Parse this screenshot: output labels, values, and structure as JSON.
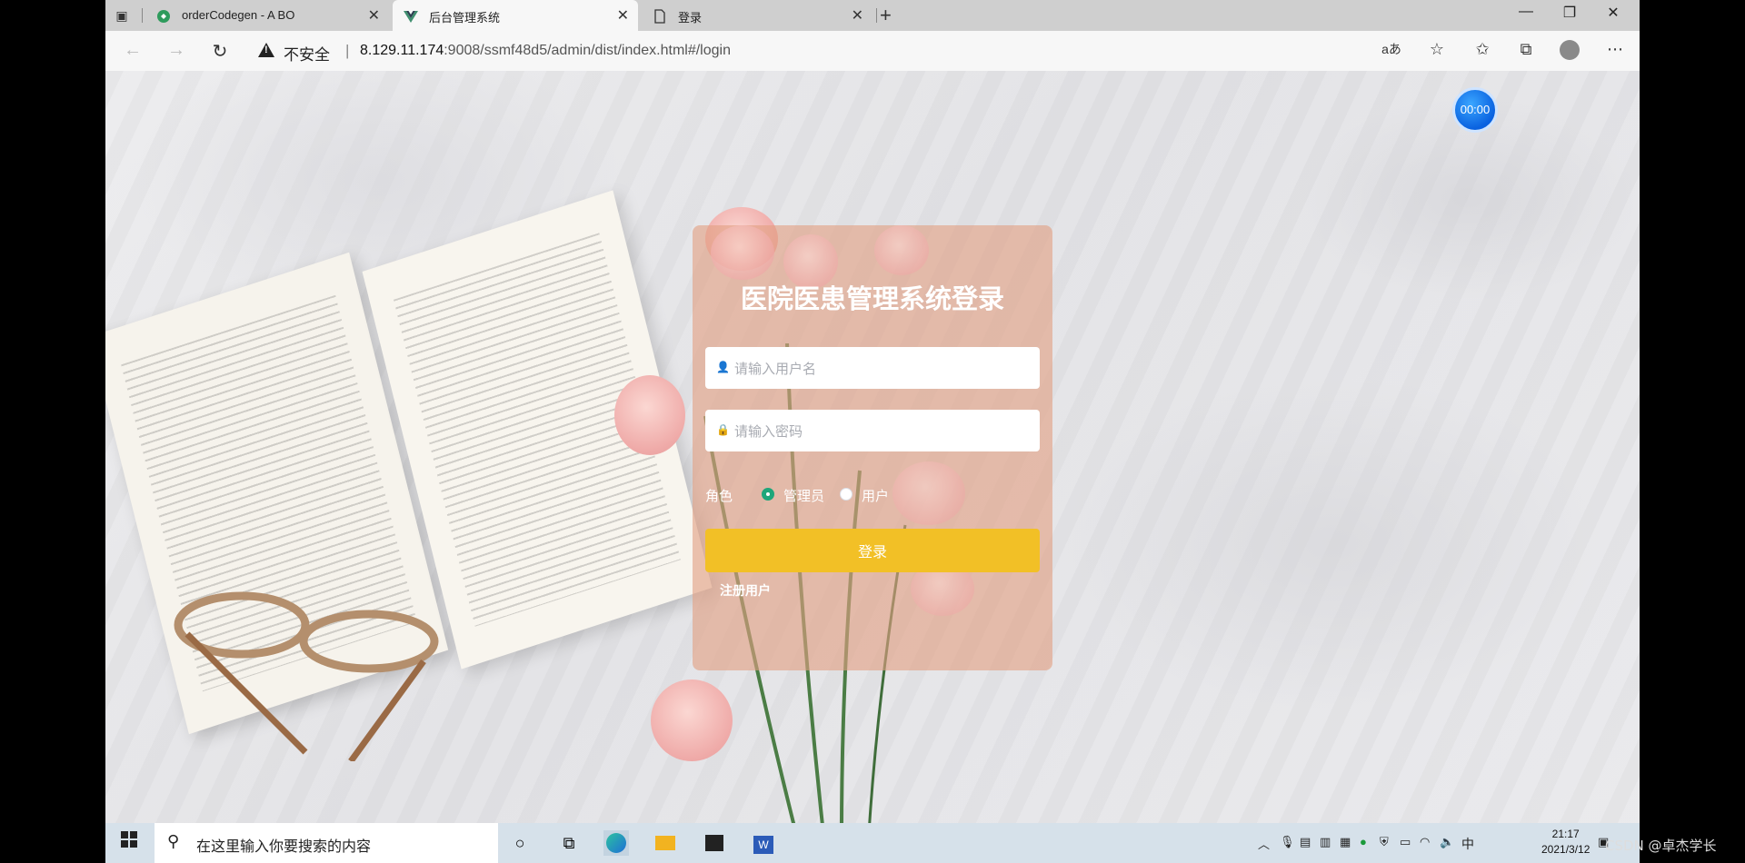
{
  "browser": {
    "tabs": [
      {
        "title": "orderCodegen - A BO",
        "favicon": "codegen-icon",
        "active": false
      },
      {
        "title": "后台管理系统",
        "favicon": "vue-icon",
        "active": true
      },
      {
        "title": "登录",
        "favicon": "page-icon",
        "active": false
      }
    ],
    "security_label": "不安全",
    "url_host": "8.129.11.174",
    "url_path": ":9008/ssmf48d5/admin/dist/index.html#/login"
  },
  "timer": "00:00",
  "login": {
    "title": "医院医患管理系统登录",
    "username_placeholder": "请输入用户名",
    "password_placeholder": "请输入密码",
    "role_label": "角色",
    "roles": [
      {
        "label": "管理员",
        "selected": true
      },
      {
        "label": "用户",
        "selected": false
      }
    ],
    "submit_label": "登录",
    "register_label": "注册用户"
  },
  "taskbar": {
    "search_placeholder": "在这里输入你要搜索的内容",
    "ime": "中",
    "time": "21:17",
    "date": "2021/3/12"
  },
  "watermark": "CSDN @卓杰学长",
  "colors": {
    "accent": "#f2c026",
    "radio": "#1ea67a",
    "card": "#e2a082"
  }
}
